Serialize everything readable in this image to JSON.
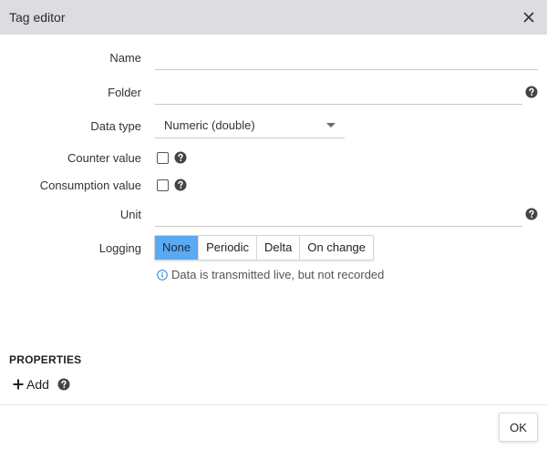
{
  "dialog": {
    "title": "Tag editor",
    "close_icon": "close-icon"
  },
  "form": {
    "name": {
      "label": "Name",
      "value": ""
    },
    "folder": {
      "label": "Folder",
      "value": ""
    },
    "data_type": {
      "label": "Data type",
      "selected": "Numeric (double)"
    },
    "counter_value": {
      "label": "Counter value",
      "checked": false
    },
    "consumption_value": {
      "label": "Consumption value",
      "checked": false
    },
    "unit": {
      "label": "Unit",
      "value": ""
    },
    "logging": {
      "label": "Logging",
      "options": [
        "None",
        "Periodic",
        "Delta",
        "On change"
      ],
      "selected": "None",
      "info": "Data is transmitted live, but not recorded"
    }
  },
  "properties": {
    "title": "PROPERTIES",
    "add_label": "Add"
  },
  "footer": {
    "ok_label": "OK"
  },
  "colors": {
    "titlebar_bg": "#dddde1",
    "accent": "#5aa9f2",
    "help_icon": "#444444"
  },
  "icons": [
    "close-icon",
    "help-icon",
    "info-icon",
    "plus-icon",
    "chevron-down-icon"
  ]
}
